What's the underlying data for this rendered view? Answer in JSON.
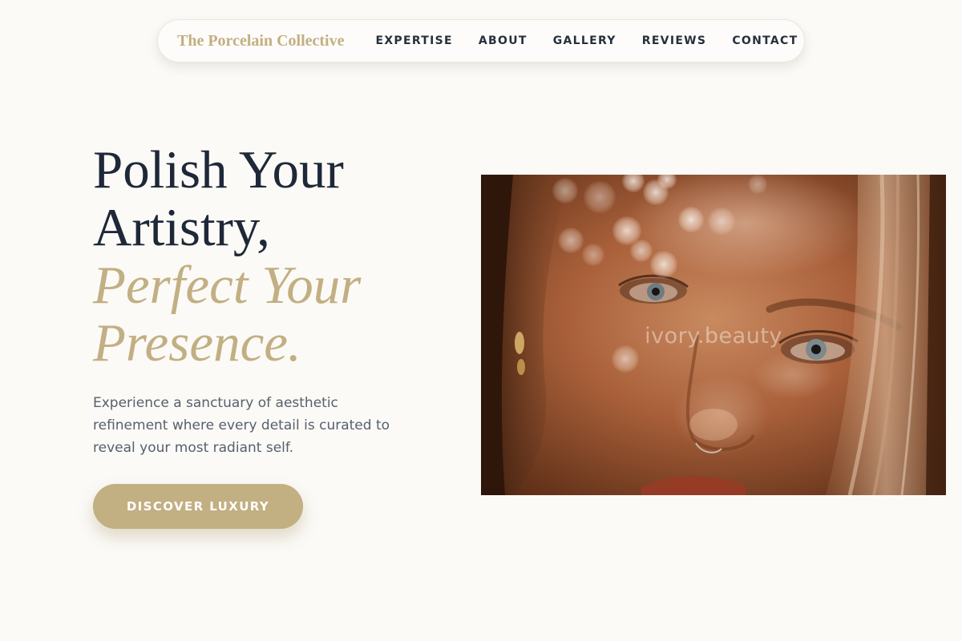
{
  "nav": {
    "brand": "The Porcelain Collective",
    "links": [
      "EXPERTISE",
      "ABOUT",
      "GALLERY",
      "REVIEWS",
      "CONTACT"
    ]
  },
  "hero": {
    "headline_line1": "Polish Your",
    "headline_line2": "Artistry,",
    "headline_accent_line1": "Perfect Your",
    "headline_accent_line2": "Presence.",
    "lead": "Experience a sanctuary of aesthetic refinement where every detail is curated to reveal your most radiant self.",
    "cta_label": "DISCOVER LUXURY",
    "image_watermark": "ivory.beauty"
  },
  "colors": {
    "background": "#fbfaf7",
    "accent_gold": "#c2af82",
    "headline_navy": "#1e2838",
    "body_gray": "#56606c"
  }
}
